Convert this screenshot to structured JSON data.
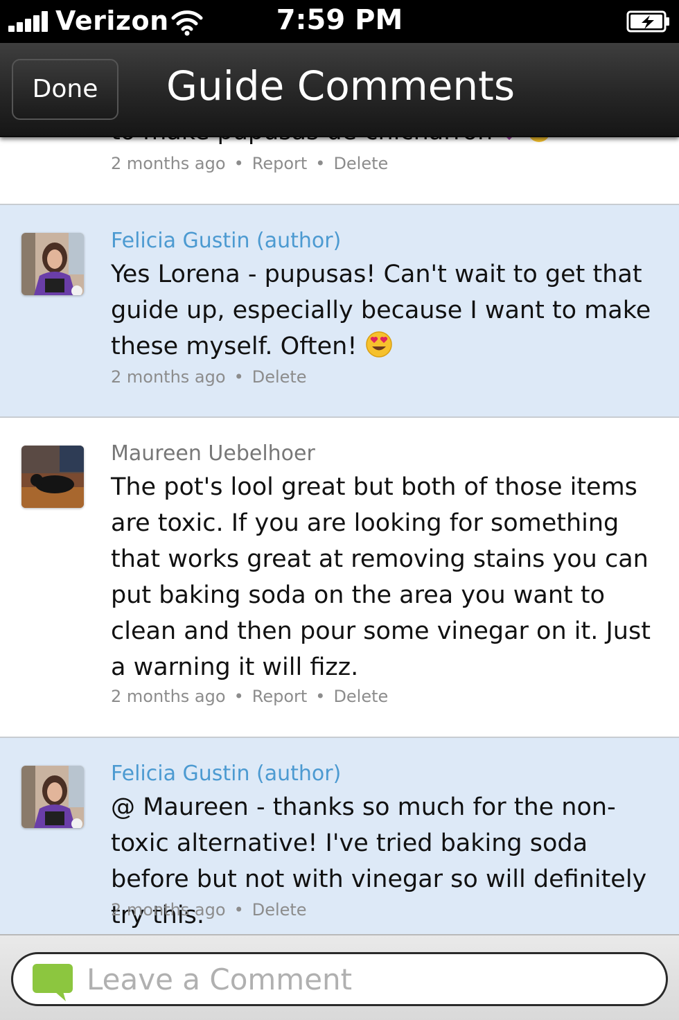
{
  "status_bar": {
    "carrier": "Verizon",
    "time": "7:59 PM"
  },
  "nav": {
    "done_label": "Done",
    "title": "Guide Comments"
  },
  "partial_comment": {
    "text_fragment": "to make pupusas de chicharron",
    "time": "2 months ago",
    "report_label": "Report",
    "delete_label": "Delete"
  },
  "comments": [
    {
      "author": "Felicia Gustin (author)",
      "is_author": true,
      "text": "Yes Lorena - pupusas! Can't wait to get that guide up, especially because I want to make these myself. Often!",
      "emoji": "heart-eyes-emoji",
      "time": "2 months ago",
      "delete_label": "Delete"
    },
    {
      "author": "Maureen Uebelhoer",
      "is_author": false,
      "text": "The pot's lool great but both of those items are toxic. If you are looking for something that works great at removing stains you can put baking soda on the area you want to clean and then pour some vinegar on it. Just a warning it will fizz.",
      "time": "2 months ago",
      "report_label": "Report",
      "delete_label": "Delete"
    },
    {
      "author": "Felicia Gustin (author)",
      "is_author": true,
      "text": "@ Maureen - thanks so much for the non-toxic alternative! I've tried baking soda before but not with vinegar so will definitely try this.",
      "time": "2 months ago",
      "delete_label": "Delete"
    }
  ],
  "composer": {
    "placeholder": "Leave a Comment",
    "icon": "chat-bubble-icon"
  },
  "colors": {
    "author_background": "#dde9f7",
    "author_name": "#4c9ad1",
    "chat_icon": "#8cc63f"
  }
}
